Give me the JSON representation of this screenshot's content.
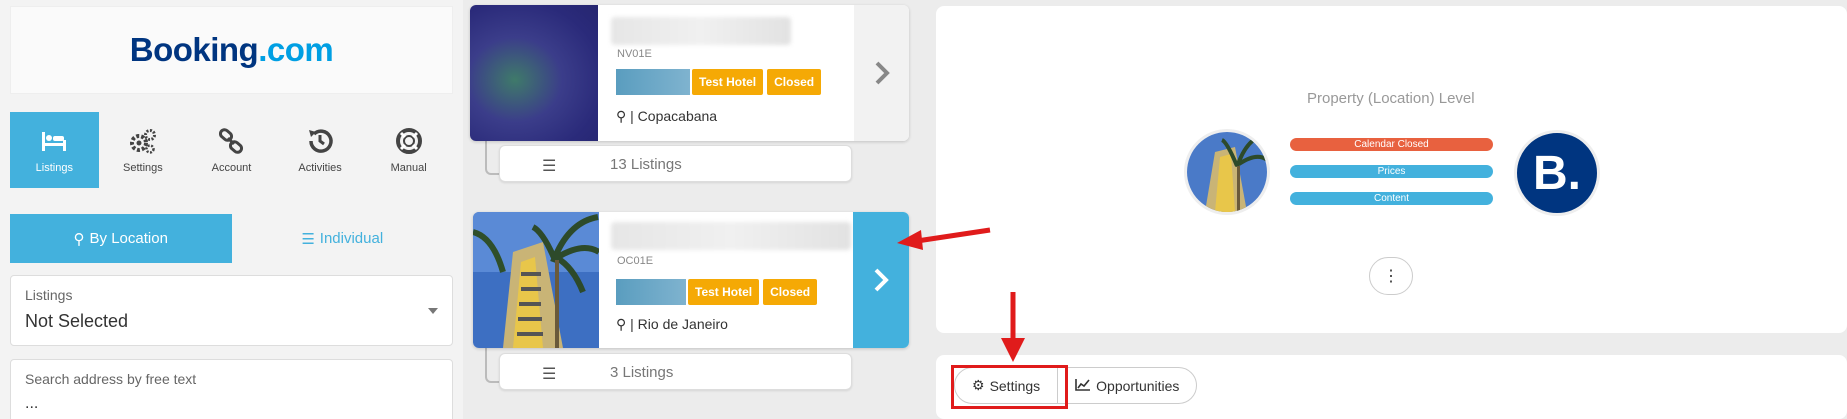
{
  "brand": {
    "logo_main": "Booking",
    "logo_dot": ".",
    "logo_tld": "com"
  },
  "nav": {
    "items": [
      {
        "label": "Listings",
        "icon": "bed-icon"
      },
      {
        "label": "Settings",
        "icon": "gears-icon"
      },
      {
        "label": "Account",
        "icon": "link-icon"
      },
      {
        "label": "Activities",
        "icon": "history-icon"
      },
      {
        "label": "Manual",
        "icon": "lifebuoy-icon"
      }
    ]
  },
  "view_toggle": {
    "by_location": "By Location",
    "individual": "Individual"
  },
  "listings_filter": {
    "label": "Listings",
    "value": "Not Selected"
  },
  "search": {
    "label": "Search address by free text",
    "value": "..."
  },
  "cards": [
    {
      "code": "NV01E",
      "badge_test": "Test Hotel",
      "badge_status": "Closed",
      "location": "| Copacabana",
      "listings": "13 Listings"
    },
    {
      "code": "OC01E",
      "badge_test": "Test Hotel",
      "badge_status": "Closed",
      "location": "| Rio de Janeiro",
      "listings": "3 Listings"
    }
  ],
  "panel": {
    "title": "Property (Location) Level",
    "pills": [
      {
        "label": "Calendar Closed",
        "color": "#e8613f"
      },
      {
        "label": "Prices",
        "color": "#43b1dd"
      },
      {
        "label": "Content",
        "color": "#43b1dd"
      }
    ],
    "channel_logo": "B.",
    "more_icon": "⋮"
  },
  "tabs": {
    "settings": "Settings",
    "opportunities": "Opportunities"
  },
  "colors": {
    "accent": "#43b1dd",
    "badge": "#f5a905",
    "highlight": "#e01b1b",
    "booking_blue": "#003580"
  }
}
